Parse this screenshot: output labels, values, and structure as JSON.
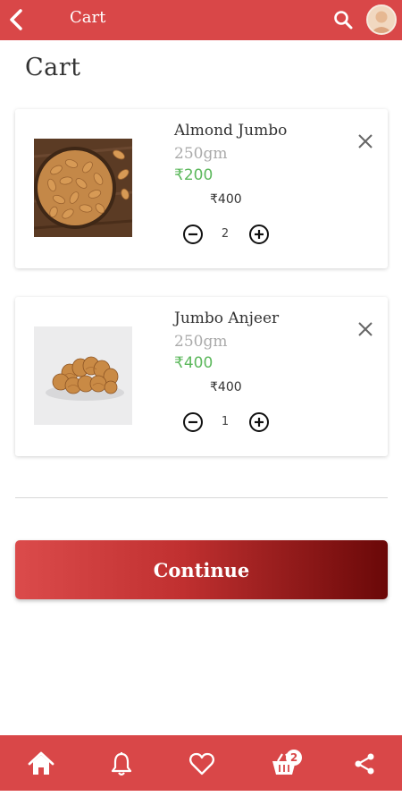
{
  "header": {
    "title": "Cart",
    "bar_color": "#d94748",
    "back_icon": "chevron-left-icon",
    "search_icon": "search-icon",
    "avatar_icon": "avatar-icon"
  },
  "page": {
    "title": "Cart"
  },
  "cart": {
    "items": [
      {
        "name": "Almond Jumbo",
        "weight": "250gm",
        "price": "₹200",
        "mrp": "₹400",
        "quantity": "2"
      },
      {
        "name": "Jumbo Anjeer",
        "weight": "250gm",
        "price": "₹400",
        "mrp": "₹400",
        "quantity": "1"
      }
    ]
  },
  "actions": {
    "continue_label": "Continue"
  },
  "bottom_nav": {
    "items": [
      {
        "icon": "home-icon"
      },
      {
        "icon": "bell-icon"
      },
      {
        "icon": "heart-icon"
      },
      {
        "icon": "basket-icon"
      },
      {
        "icon": "share-icon"
      }
    ],
    "cart_badge": "2"
  },
  "colors": {
    "price_green": "#5cb85c",
    "accent_red": "#d94748",
    "dark_red": "#6a0808"
  }
}
